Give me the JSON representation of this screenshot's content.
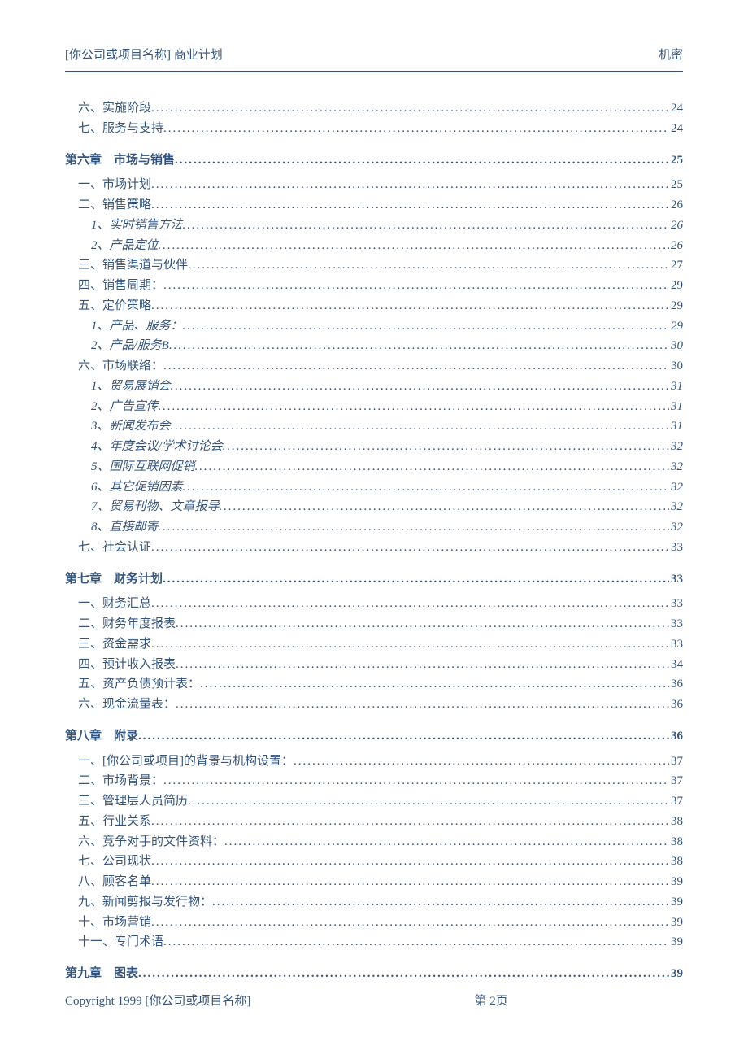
{
  "header": {
    "left": "[你公司或项目名称] 商业计划",
    "right": "机密"
  },
  "footer": {
    "left": "Copyright 1999 [你公司或项目名称]",
    "center": "第 2页"
  },
  "toc": [
    {
      "level": 2,
      "label": "六、实施阶段",
      "page": "24"
    },
    {
      "level": 2,
      "label": "七、服务与支持",
      "page": "24"
    },
    {
      "level": 1,
      "label": "第六章　市场与销售",
      "page": "25"
    },
    {
      "level": 2,
      "label": "一、市场计划",
      "page": "25"
    },
    {
      "level": 2,
      "label": "二、销售策略",
      "page": "26"
    },
    {
      "level": 3,
      "label": "1、实时销售方法",
      "page": "26"
    },
    {
      "level": 3,
      "label": "2、产品定位",
      "page": "26"
    },
    {
      "level": 2,
      "label": "三、销售渠道与伙伴",
      "page": "27"
    },
    {
      "level": 2,
      "label": "四、销售周期：",
      "page": "29"
    },
    {
      "level": 2,
      "label": "五、定价策略",
      "page": "29"
    },
    {
      "level": 3,
      "label": "1、产品、服务：",
      "page": "29"
    },
    {
      "level": 3,
      "label": "2、产品/服务B",
      "page": "30"
    },
    {
      "level": 2,
      "label": "六、市场联络：",
      "page": "30"
    },
    {
      "level": 3,
      "label": "1、贸易展销会",
      "page": "31"
    },
    {
      "level": 3,
      "label": "2、广告宣传",
      "page": "31"
    },
    {
      "level": 3,
      "label": "3、新闻发布会",
      "page": "31"
    },
    {
      "level": 3,
      "label": "4、年度会议/学术讨论会",
      "page": "32"
    },
    {
      "level": 3,
      "label": "5、国际互联网促销",
      "page": "32"
    },
    {
      "level": 3,
      "label": "6、其它促销因素",
      "page": "32"
    },
    {
      "level": 3,
      "label": "7、贸易刊物、文章报导",
      "page": "32"
    },
    {
      "level": 3,
      "label": "8、直接邮寄",
      "page": "32"
    },
    {
      "level": 2,
      "label": "七、社会认证",
      "page": "33"
    },
    {
      "level": 1,
      "label": "第七章　财务计划",
      "page": "33"
    },
    {
      "level": 2,
      "label": "一、财务汇总",
      "page": "33"
    },
    {
      "level": 2,
      "label": "二、财务年度报表",
      "page": "33"
    },
    {
      "level": 2,
      "label": "三、资金需求",
      "page": "33"
    },
    {
      "level": 2,
      "label": "四、预计收入报表",
      "page": "34"
    },
    {
      "level": 2,
      "label": "五、资产负债预计表：",
      "page": "36"
    },
    {
      "level": 2,
      "label": "六、现金流量表：",
      "page": "36"
    },
    {
      "level": 1,
      "label": "第八章　附录",
      "page": "36"
    },
    {
      "level": 2,
      "label": "一、[你公司或项目]的背景与机构设置：",
      "page": "37"
    },
    {
      "level": 2,
      "label": "二、市场背景：",
      "page": "37"
    },
    {
      "level": 2,
      "label": "三、管理层人员简历",
      "page": "37"
    },
    {
      "level": 2,
      "label": "五、行业关系",
      "page": "38"
    },
    {
      "level": 2,
      "label": "六、竞争对手的文件资料：",
      "page": "38"
    },
    {
      "level": 2,
      "label": "七、公司现状",
      "page": "38"
    },
    {
      "level": 2,
      "label": "八、顾客名单",
      "page": "39"
    },
    {
      "level": 2,
      "label": "九、新闻剪报与发行物：",
      "page": "39"
    },
    {
      "level": 2,
      "label": "十、市场营销",
      "page": "39"
    },
    {
      "level": 2,
      "label": "十一、专门术语",
      "page": "39"
    },
    {
      "level": 1,
      "label": "第九章　图表",
      "page": "39"
    }
  ]
}
